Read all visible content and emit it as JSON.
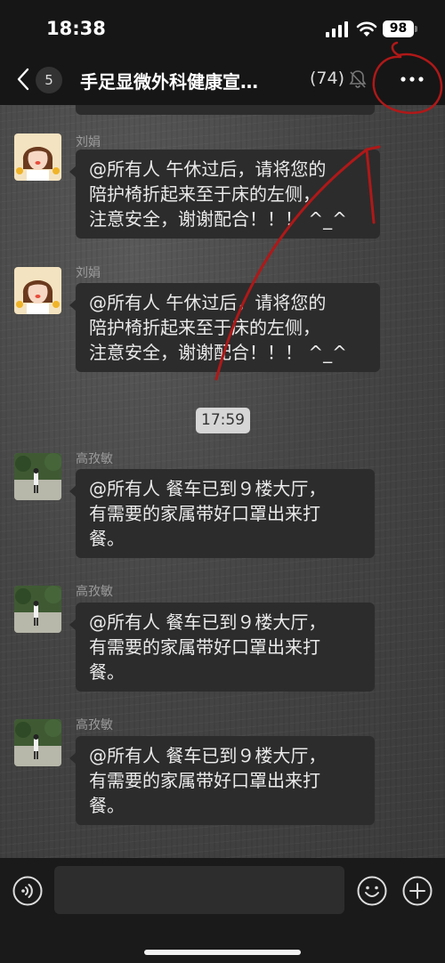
{
  "status_bar": {
    "time": "18:38",
    "battery": "98",
    "icons": [
      "signal-icon",
      "wifi-icon",
      "battery-icon"
    ]
  },
  "nav": {
    "back_icon": "chevron-left-icon",
    "unread_count": "5",
    "title": "手足显微外科健康宣…",
    "member_count": "(74)",
    "mute_icon": "bell-slash-icon",
    "more_icon": "ellipsis-icon"
  },
  "messages": [
    {
      "sender": "刘娟",
      "lines": [
        "@所有人 午休过后，请将您的",
        "陪护椅折起来至于床的左侧，",
        "注意安全，谢谢配合！！！ ^_^"
      ]
    },
    {
      "sender": "刘娟",
      "lines": [
        "@所有人 午休过后，请将您的",
        "陪护椅折起来至于床的左侧，",
        "注意安全，谢谢配合！！！ ^_^"
      ]
    },
    {
      "sender": "高孜敏",
      "lines": [
        "@所有人 餐车已到９楼大厅，",
        "有需要的家属带好口罩出来打",
        "餐。"
      ]
    },
    {
      "sender": "高孜敏",
      "lines": [
        "@所有人 餐车已到９楼大厅，",
        "有需要的家属带好口罩出来打",
        "餐。"
      ]
    },
    {
      "sender": "高孜敏",
      "lines": [
        "@所有人 餐车已到９楼大厅，",
        "有需要的家属带好口罩出来打",
        "餐。"
      ]
    }
  ],
  "time_divider": "17:59",
  "input_bar": {
    "placeholder": "",
    "icons": [
      "voice-icon",
      "emoji-icon",
      "plus-icon"
    ]
  },
  "colors": {
    "bubble": "#2c2c2c",
    "annotation": "#b01818",
    "bar": "#161616"
  }
}
